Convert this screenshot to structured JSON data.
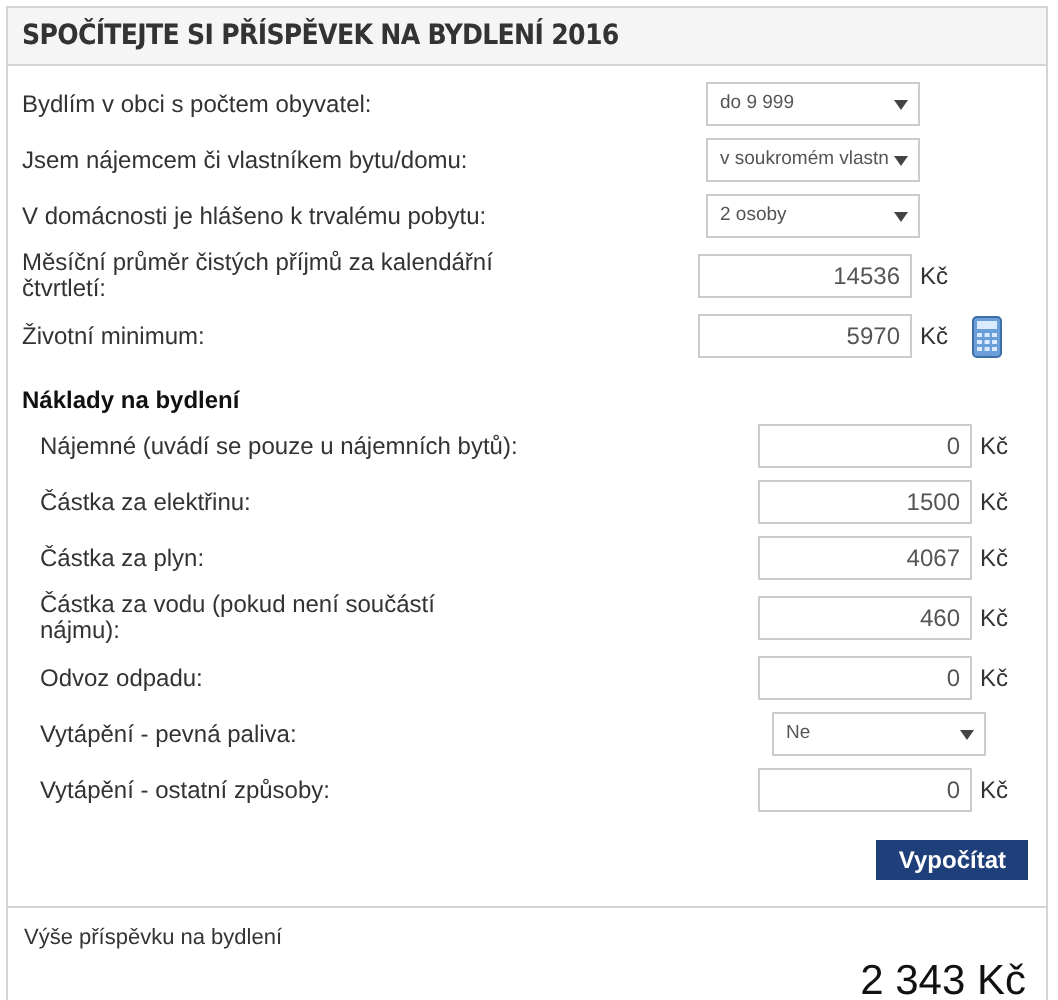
{
  "title": "SPOČÍTEJTE SI PŘÍSPĚVEK NA BYDLENÍ 2016",
  "fields": [
    {
      "kind": "select",
      "label": "Bydlím v obci s počtem obyvatel:",
      "value": "do 9 999"
    },
    {
      "kind": "select",
      "label": "Jsem nájemcem či vlastníkem bytu/domu:",
      "value": "v soukromém vlastn"
    },
    {
      "kind": "select",
      "label": "V domácnosti je hlášeno k trvalému pobytu:",
      "value": "2 osoby"
    },
    {
      "kind": "input",
      "label": "Měsíční průměr čistých příjmů za kalendářní čtvrtletí:",
      "value": "14536",
      "unit": "Kč"
    },
    {
      "kind": "input",
      "label": "Životní minimum:",
      "value": "5970",
      "unit": "Kč",
      "calculator": true
    }
  ],
  "costs_heading": "Náklady na bydlení",
  "costs": [
    {
      "kind": "input",
      "label": "Nájemné (uvádí se pouze u nájemních bytů):",
      "value": "0",
      "unit": "Kč"
    },
    {
      "kind": "input",
      "label": "Částka za elektřinu:",
      "value": "1500",
      "unit": "Kč"
    },
    {
      "kind": "input",
      "label": "Částka za plyn:",
      "value": "4067",
      "unit": "Kč"
    },
    {
      "kind": "input",
      "label": "Částka za vodu (pokud není součástí nájmu):",
      "value": "460",
      "unit": "Kč"
    },
    {
      "kind": "input",
      "label": "Odvoz odpadu:",
      "value": "0",
      "unit": "Kč"
    },
    {
      "kind": "select",
      "label": "Vytápění - pevná paliva:",
      "value": "Ne"
    },
    {
      "kind": "input",
      "label": "Vytápění - ostatní způsoby:",
      "value": "0",
      "unit": "Kč"
    }
  ],
  "button": "Vypočítat",
  "result": {
    "label": "Výše příspěvku na bydlení",
    "value": "2 343 Kč"
  }
}
